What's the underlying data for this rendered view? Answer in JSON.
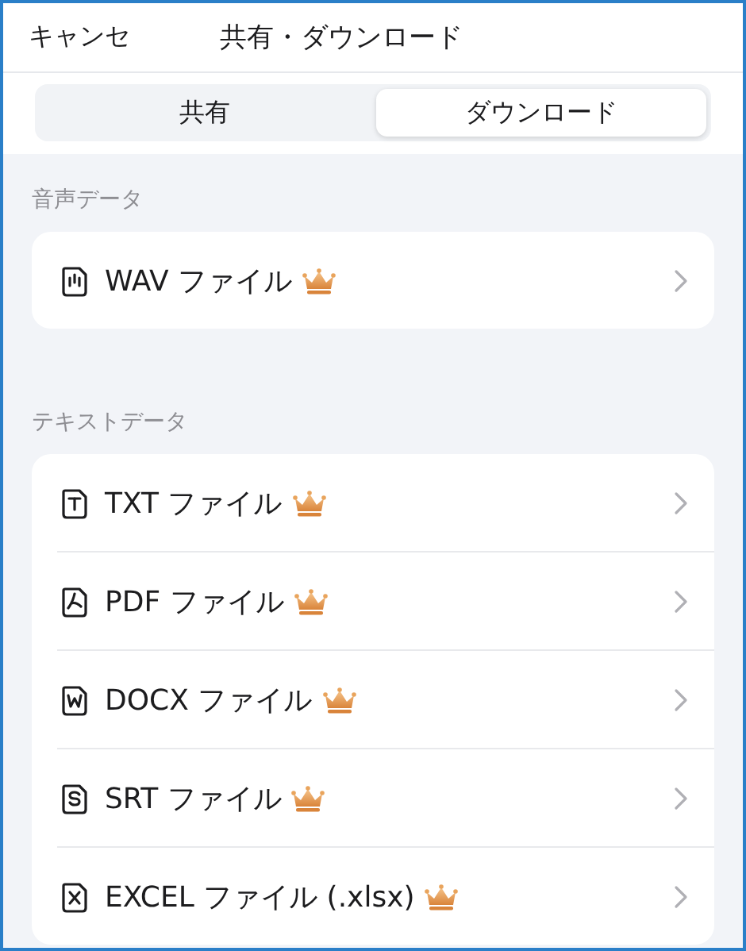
{
  "header": {
    "cancel": "キャンセ",
    "title": "共有・ダウンロード"
  },
  "tabs": [
    {
      "label": "共有",
      "selected": false
    },
    {
      "label": "ダウンロード",
      "selected": true
    }
  ],
  "sections": [
    {
      "title": "音声データ",
      "items": [
        {
          "kind": "audio",
          "label": "WAV ファイル",
          "premium": true
        }
      ]
    },
    {
      "title": "テキストデータ",
      "items": [
        {
          "kind": "txt",
          "label": "TXT ファイル",
          "premium": true
        },
        {
          "kind": "pdf",
          "label": "PDF ファイル",
          "premium": true
        },
        {
          "kind": "docx",
          "label": "DOCX ファイル",
          "premium": true
        },
        {
          "kind": "srt",
          "label": "SRT ファイル",
          "premium": true
        },
        {
          "kind": "xlsx",
          "label": "EXCEL ファイル (.xlsx)",
          "premium": true
        }
      ]
    }
  ]
}
